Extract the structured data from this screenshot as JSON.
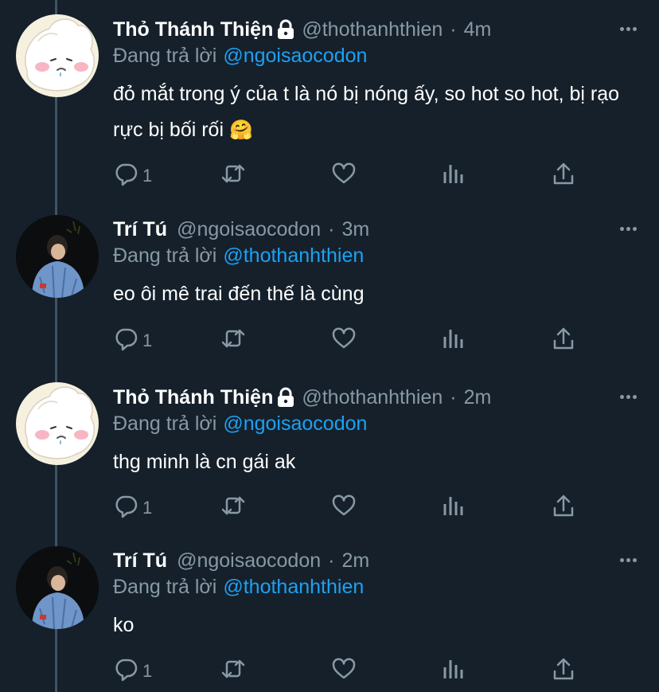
{
  "tweets": [
    {
      "name": "Thỏ Thánh Thiện",
      "handle": "@thothanhthien",
      "time": "4m",
      "locked": true,
      "replying_prefix": "Đang trả lời",
      "replying_to": "@ngoisaocodon",
      "text": "đỏ mắt trong ý của t là nó bị nóng ấy, so hot so hot, bị rạo rực bị bối rối",
      "emoji": "🤗",
      "reply_count": "1"
    },
    {
      "name": "Trí Tú",
      "handle": "@ngoisaocodon",
      "time": "3m",
      "locked": false,
      "replying_prefix": "Đang trả lời",
      "replying_to": "@thothanhthien",
      "text": "eo ôi mê trai đến thế là cùng",
      "reply_count": "1"
    },
    {
      "name": "Thỏ Thánh Thiện",
      "handle": "@thothanhthien",
      "time": "2m",
      "locked": true,
      "replying_prefix": "Đang trả lời",
      "replying_to": "@ngoisaocodon",
      "text": "thg minh là cn gái ak",
      "reply_count": "1"
    },
    {
      "name": "Trí Tú",
      "handle": "@ngoisaocodon",
      "time": "2m",
      "locked": false,
      "replying_prefix": "Đang trả lời",
      "replying_to": "@thothanhthien",
      "text": "ko",
      "reply_count": "1"
    }
  ],
  "separator": "·",
  "icons": {
    "reply": "reply-icon",
    "retweet": "retweet-icon",
    "like": "heart-icon",
    "analytics": "analytics-icon",
    "share": "share-icon",
    "more": "more-icon",
    "lock": "lock-icon"
  },
  "colors": {
    "background": "#15202b",
    "text": "#ffffff",
    "muted": "#8899a6",
    "link": "#1da1f2"
  }
}
